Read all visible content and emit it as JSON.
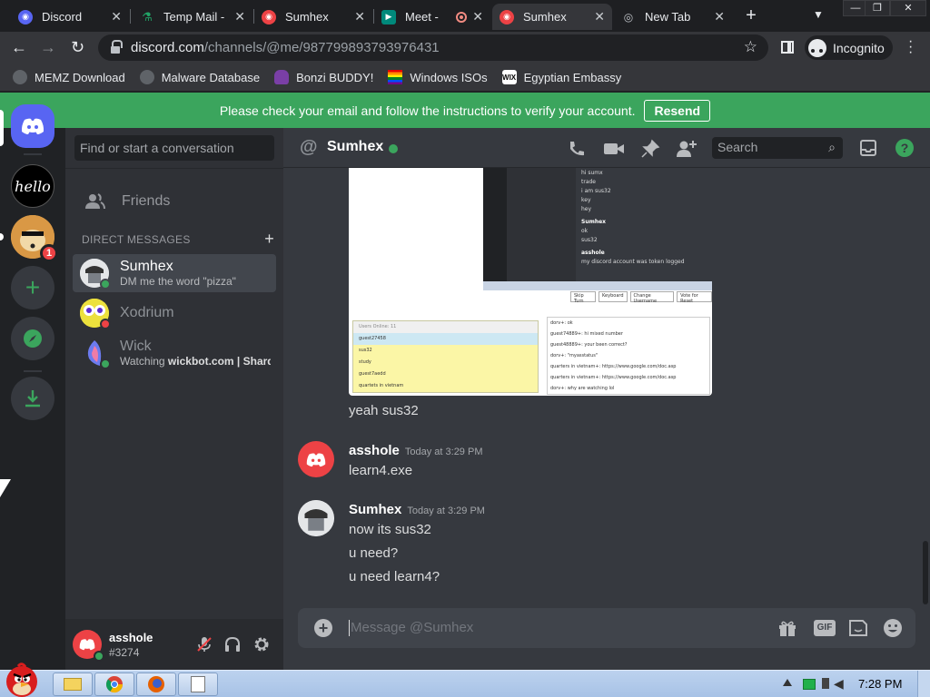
{
  "browser": {
    "tabs": [
      {
        "title": "Discord",
        "icon": "discord-icon",
        "color": "#5865f2"
      },
      {
        "title": "Temp Mail -",
        "icon": "tempmail-icon",
        "color": "#21a366"
      },
      {
        "title": "Sumhex",
        "icon": "discord-red-icon",
        "color": "#ed4245"
      },
      {
        "title": "Meet -",
        "icon": "meet-icon",
        "color": "#00897b"
      },
      {
        "title": "Sumhex",
        "icon": "discord-red-icon",
        "color": "#ed4245"
      },
      {
        "title": "New Tab",
        "icon": "incognito-icon",
        "color": "#9aa0a6"
      }
    ],
    "url_domain": "discord.com",
    "url_path": "/channels/@me/987799893793976431",
    "profile_label": "Incognito",
    "bookmarks": [
      {
        "label": "MEMZ Download",
        "icon": "globe-icon"
      },
      {
        "label": "Malware Database",
        "icon": "globe-icon"
      },
      {
        "label": "Bonzi BUDDY!",
        "icon": "bonzi-icon"
      },
      {
        "label": "Windows ISOs",
        "icon": "rainbow-flag-icon"
      },
      {
        "label": "Egyptian Embassy",
        "icon": "wix-icon"
      }
    ]
  },
  "banner": {
    "text": "Please check your email and follow the instructions to verify your account.",
    "button": "Resend"
  },
  "guilds": {
    "server_labels": [
      "hello"
    ],
    "mention_count": "1"
  },
  "dm_sidebar": {
    "search_placeholder": "Find or start a conversation",
    "friends_label": "Friends",
    "dm_heading": "DIRECT MESSAGES",
    "dms": [
      {
        "name": "Sumhex",
        "status_text": "DM me the word \"pizza\"",
        "status": "online"
      },
      {
        "name": "Xodrium",
        "status_text": "",
        "status": "dnd"
      },
      {
        "name": "Wick",
        "status_prefix": "Watching ",
        "status_bold": "wickbot.com | Shard...",
        "status": "online"
      }
    ],
    "user": {
      "name": "asshole",
      "tag": "#3274"
    }
  },
  "channel": {
    "name": "Sumhex",
    "search_placeholder": "Search",
    "screenshot_right_lines": [
      "hi sumx",
      "trade",
      "i am sus32",
      "key",
      "hey",
      "Sumhex",
      "ok",
      "sus32",
      "asshole",
      "my discord account was token logged"
    ],
    "screenshot_buttons": [
      "Skip Turn",
      "Keyboard",
      "Change Username",
      "Vote for Reset"
    ],
    "screenshot_list": [
      "Users Online: 11",
      "guest27458",
      "sus32",
      "study",
      "guest7aedd",
      "quartets in vietnam"
    ],
    "screenshot_chat": [
      "dorv+: ok",
      "guest74889+: hi mixed number",
      "guest48889+: your been correct?",
      "dorv+: \"myasstatus\"",
      "quarters in vietnam+: https://www.google.com/doc.asp",
      "quarters in vietnam+: https://www.google.com/doc.asp",
      "dorv+: why are watching lol"
    ],
    "messages": [
      {
        "author": "",
        "time": "",
        "lines": [
          "yeah sus32"
        ]
      },
      {
        "author": "asshole",
        "time": "Today at 3:29 PM",
        "lines": [
          "learn4.exe"
        ]
      },
      {
        "author": "Sumhex",
        "time": "Today at 3:29 PM",
        "lines": [
          "now its sus32",
          "u need?",
          "u need learn4?"
        ]
      }
    ],
    "composer_placeholder": "Message @Sumhex",
    "gif_label": "GIF"
  },
  "taskbar": {
    "time": "7:28 PM"
  },
  "colors": {
    "discord_blurple": "#5865f2",
    "online": "#3ba55d",
    "dnd": "#ed4245",
    "banner": "#3ba55d"
  }
}
